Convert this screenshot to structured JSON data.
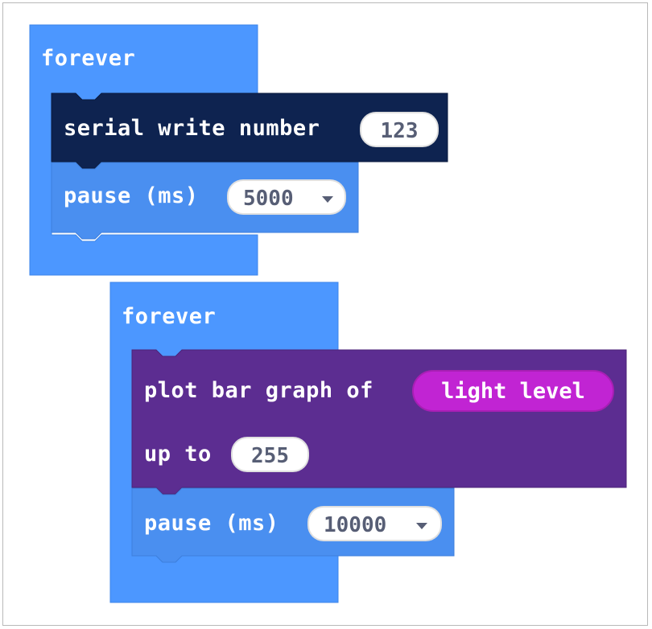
{
  "colors": {
    "loops": "#4c97ff",
    "loops_block": "#4a8ff0",
    "serial": "#0e2350",
    "led": "#5c2d91",
    "input_reporter": "#c124d3"
  },
  "stack1": {
    "hat_label": "forever",
    "serial_label": "serial write number",
    "serial_value": "123",
    "pause_label": "pause (ms)",
    "pause_value": "5000",
    "pause_caret": "▼"
  },
  "stack2": {
    "hat_label": "forever",
    "plot_label": "plot bar graph of",
    "plot_reporter": "light level",
    "upto_label": "up to",
    "upto_value": "255",
    "pause_label": "pause (ms)",
    "pause_value": "10000",
    "pause_caret": "▼"
  }
}
